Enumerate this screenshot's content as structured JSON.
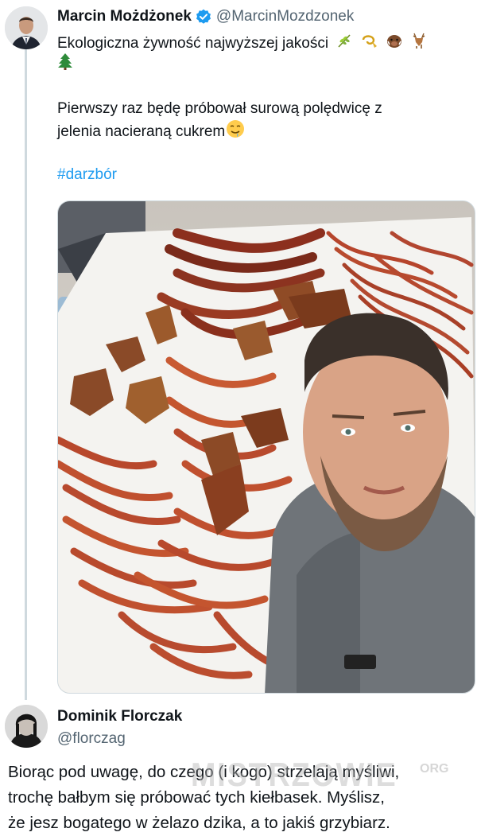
{
  "tweet": {
    "author_name": "Marcin Możdżonek",
    "handle": "@MarcinMozdzonek",
    "line1": "Ekologiczna żywność najwyższej jakości",
    "line2_emoji": "🌲",
    "line3": "Pierwszy raz będę próbował surową polędwicę z",
    "line4": "jelenia nacieraną cukrem",
    "hashtag": "#darzbór",
    "emojis": [
      "herb-icon",
      "hunting-horn-icon",
      "boar-icon",
      "deer-icon",
      "tree-icon",
      "drooling-face-icon"
    ]
  },
  "reply": {
    "author_name": "Dominik Florczak",
    "handle": "@florczag",
    "line1": "Biorąc pod uwagę, do czego (i kogo) strzelają myśliwi,",
    "line2": "trochę bałbym się próbować tych kiełbasek. Myślisz,",
    "line3": "że jesz bogatego w żelazo dzika, a to jakiś grzybiarz."
  },
  "watermark": {
    "text": "MISTRZOWIE",
    "suffix": "ORG"
  },
  "colors": {
    "link": "#1d9bf0",
    "secondary_text": "#536471",
    "verified": "#1d9bf0",
    "thread_line": "#cfd9de"
  }
}
